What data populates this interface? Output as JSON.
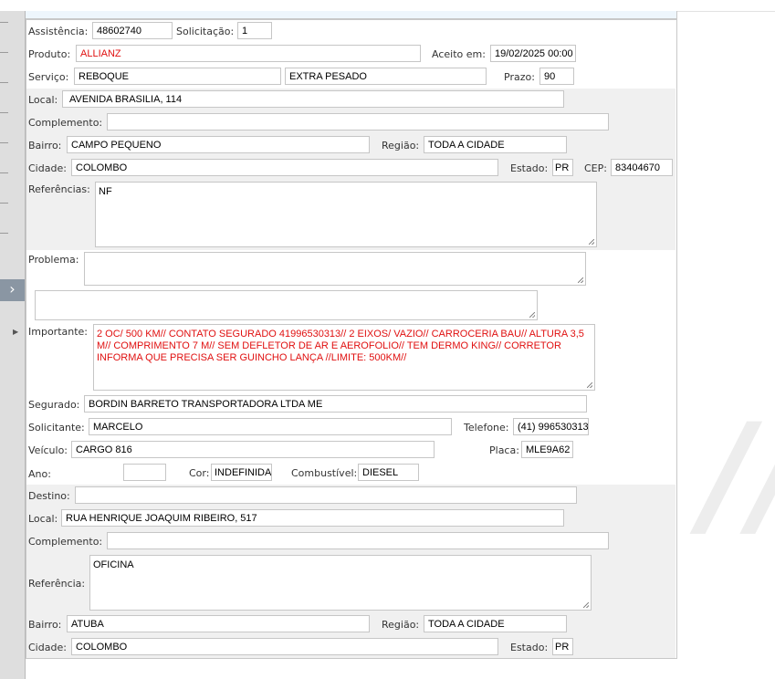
{
  "colors": {
    "accent_text": "#e01010",
    "section_bg": "#f0f0f0"
  },
  "sidebar": {
    "expand_icon": "chevron-right-double",
    "row_marker_icon": "triangle-right"
  },
  "form": {
    "assistencia": {
      "label": "Assistência:",
      "value": "48602740"
    },
    "solicitacao": {
      "label": "Solicitação:",
      "value": "1"
    },
    "produto": {
      "label": "Produto:",
      "value": "ALLIANZ"
    },
    "aceito_em": {
      "label": "Aceito em:",
      "value": "19/02/2025 00:00"
    },
    "servico": {
      "label": "Serviço:",
      "value": "REBOQUE",
      "value2": "EXTRA PESADO"
    },
    "prazo": {
      "label": "Prazo:",
      "value": "90"
    },
    "origem": {
      "local": {
        "label": "Local:",
        "value": "AVENIDA BRASILIA, 114"
      },
      "complemento": {
        "label": "Complemento:",
        "value": ""
      },
      "bairro": {
        "label": "Bairro:",
        "value": "CAMPO PEQUENO"
      },
      "regiao": {
        "label": "Região:",
        "value": "TODA A CIDADE"
      },
      "cidade": {
        "label": "Cidade:",
        "value": "COLOMBO"
      },
      "estado": {
        "label": "Estado:",
        "value": "PR"
      },
      "cep": {
        "label": "CEP:",
        "value": "83404670"
      },
      "referencias": {
        "label": "Referências:",
        "value": "NF"
      }
    },
    "problema": {
      "label": "Problema:",
      "value": "",
      "extra": ""
    },
    "importante": {
      "label": "Importante:",
      "value": "2 OC/ 500 KM// CONTATO SEGURADO 41996530313// 2 EIXOS/ VAZIO// CARROCERIA BAU// ALTURA 3,5 M// COMPRIMENTO 7 M// SEM DEFLETOR DE AR E AEROFOLIO// TEM DERMO KING// CORRETOR INFORMA QUE PRECISA SER GUINCHO LANÇA //LIMITE: 500KM//"
    },
    "segurado": {
      "label": "Segurado:",
      "value": "BORDIN BARRETO TRANSPORTADORA LTDA ME"
    },
    "solicitante": {
      "label": "Solicitante:",
      "value": "MARCELO"
    },
    "telefone": {
      "label": "Telefone:",
      "value": "(41) 996530313"
    },
    "veiculo": {
      "label": "Veículo:",
      "value": "CARGO 816"
    },
    "placa": {
      "label": "Placa:",
      "value": "MLE9A62"
    },
    "ano": {
      "label": "Ano:",
      "value": ""
    },
    "cor": {
      "label": "Cor:",
      "value": "INDEFINIDA"
    },
    "combustivel": {
      "label": "Combustível:",
      "value": "DIESEL"
    },
    "destino": {
      "destino": {
        "label": "Destino:",
        "value": ""
      },
      "local": {
        "label": "Local:",
        "value": "RUA HENRIQUE JOAQUIM RIBEIRO, 517"
      },
      "complemento": {
        "label": "Complemento:",
        "value": ""
      },
      "referencia": {
        "label": "Referência:",
        "value": "OFICINA"
      },
      "bairro": {
        "label": "Bairro:",
        "value": "ATUBA"
      },
      "regiao": {
        "label": "Região:",
        "value": "TODA A CIDADE"
      },
      "cidade": {
        "label": "Cidade:",
        "value": "COLOMBO"
      },
      "estado": {
        "label": "Estado:",
        "value": "PR"
      }
    }
  }
}
